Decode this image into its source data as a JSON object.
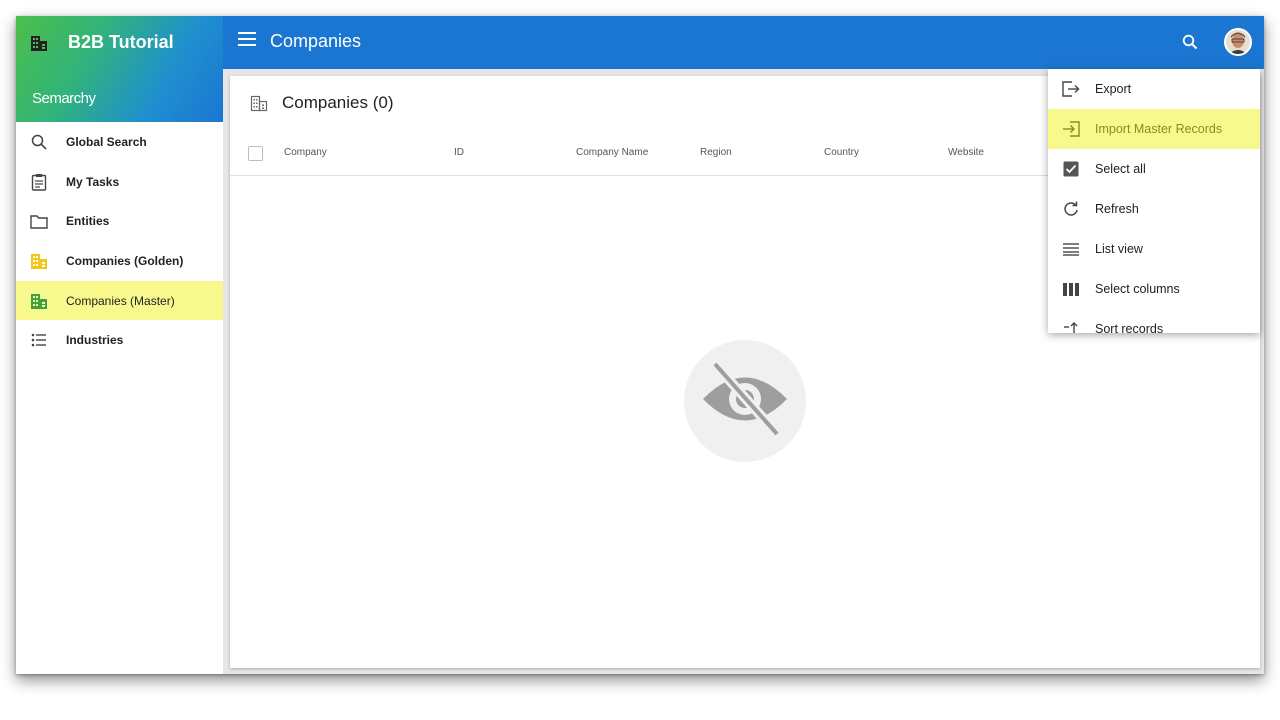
{
  "app": {
    "name": "B2B Tutorial",
    "brand": "Semarchy"
  },
  "appbar": {
    "title": "Companies"
  },
  "sidebar": {
    "items": [
      {
        "label": "Global Search",
        "icon": "search-icon"
      },
      {
        "label": "My Tasks",
        "icon": "clipboard-icon"
      },
      {
        "label": "Entities",
        "icon": "folder-icon"
      },
      {
        "label": "Companies (Golden)",
        "icon": "building-icon"
      },
      {
        "label": "Companies (Master)",
        "icon": "building-icon"
      },
      {
        "label": "Industries",
        "icon": "list-icon"
      }
    ],
    "active_index": 4
  },
  "main": {
    "title": "Companies (0)",
    "columns": [
      "Company",
      "ID",
      "Company Name",
      "Region",
      "Country",
      "Website"
    ],
    "empty_icon": "eye-off-icon"
  },
  "menu": {
    "items": [
      {
        "label": "Export",
        "icon": "export-icon"
      },
      {
        "label": "Import Master Records",
        "icon": "import-icon"
      },
      {
        "label": "Select all",
        "icon": "checkbox-checked-icon"
      },
      {
        "label": "Refresh",
        "icon": "refresh-icon"
      },
      {
        "label": "List view",
        "icon": "list-view-icon"
      },
      {
        "label": "Select columns",
        "icon": "columns-icon"
      },
      {
        "label": "Sort records",
        "icon": "sort-icon"
      }
    ],
    "highlight_index": 1
  },
  "colors": {
    "appbar": "#1b76d2",
    "highlight": "#f8f98c",
    "golden_icon": "#f5c518",
    "master_icon": "#43a047"
  }
}
